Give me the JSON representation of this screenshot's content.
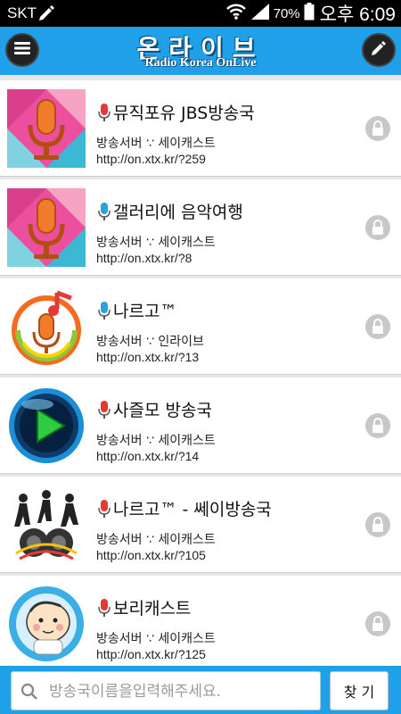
{
  "status_bar": {
    "carrier": "SKT",
    "battery": "70%",
    "time": "오후 6:09"
  },
  "header": {
    "title": "온라이브",
    "subtitle": "Radio Korea OnLive",
    "menu_icon": "hamburger-menu-icon",
    "edit_icon": "pencil-icon",
    "color": "#1fa0e8"
  },
  "stations": [
    {
      "name": "뮤직포유 JBS방송국",
      "server": "방송서버 ∵ 세이캐스트",
      "url": "http://on.xtx.kr/?259",
      "thumb": "microphone-logo",
      "mic_color": "#e53935"
    },
    {
      "name": "갤러리에 음악여행",
      "server": "방송서버 ∵ 세이캐스트",
      "url": "http://on.xtx.kr/?8",
      "thumb": "microphone-logo",
      "mic_color": "#29a3d6"
    },
    {
      "name": "나르고™",
      "server": "방송서버 ∵ 인라이브",
      "url": "http://on.xtx.kr/?13",
      "thumb": "music-note-mic-logo",
      "mic_color": "#29a3d6"
    },
    {
      "name": "사즐모 방송국",
      "server": "방송서버 ∵ 세이캐스트",
      "url": "http://on.xtx.kr/?14",
      "thumb": "play-button-logo",
      "mic_color": "#e53935"
    },
    {
      "name": "나르고™ - 쎄이방송국",
      "server": "방송서버 ∵ 세이캐스트",
      "url": "http://on.xtx.kr/?105",
      "thumb": "dancers-speaker-logo",
      "mic_color": "#e53935"
    },
    {
      "name": "보리캐스트",
      "server": "방송서버 ∵ 세이캐스트",
      "url": "http://on.xtx.kr/?125",
      "thumb": "cartoon-face-logo",
      "mic_color": "#e53935"
    }
  ],
  "search": {
    "placeholder": "방송국이름을입력해주세요.",
    "value": "",
    "button_label": "찾 기"
  }
}
